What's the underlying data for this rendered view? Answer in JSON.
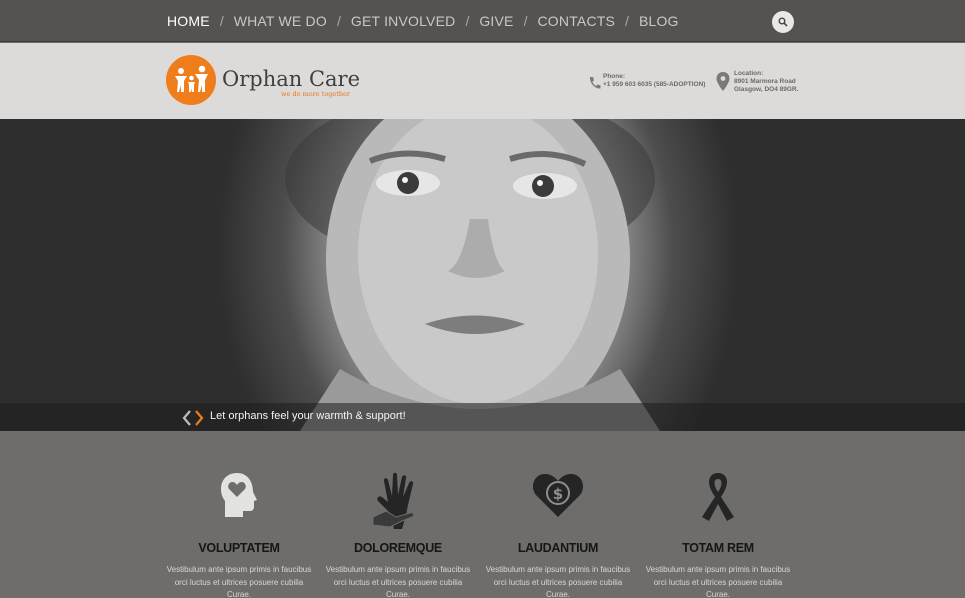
{
  "nav": {
    "items": [
      {
        "label": "HOME",
        "active": true
      },
      {
        "label": "WHAT WE DO"
      },
      {
        "label": "GET INVOLVED"
      },
      {
        "label": "GIVE"
      },
      {
        "label": "CONTACTS"
      },
      {
        "label": "BLOG"
      }
    ],
    "separator": "/",
    "search_icon": "search-icon"
  },
  "header": {
    "brand_name": "Orphan Care",
    "tagline": "we do more together",
    "phone": {
      "label": "Phone:",
      "value": "+1 959 603 6035 (585-ADOPTION)"
    },
    "location": {
      "label": "Location:",
      "line1": "8901 Marmora Road",
      "line2": "Glasgow, DO4 89GR."
    }
  },
  "hero": {
    "caption": "Let orphans feel your warmth & support!"
  },
  "features": [
    {
      "icon": "head-heart-icon",
      "title": "VOLUPTATEM",
      "text": "Vestibulum ante ipsum primis in faucibus orci luctus et ultrices posuere cubilia Curae."
    },
    {
      "icon": "helping-hands-icon",
      "title": "DOLOREMQUE",
      "text": "Vestibulum ante ipsum primis in faucibus orci luctus et ultrices posuere cubilia Curae."
    },
    {
      "icon": "heart-dollar-icon",
      "title": "LAUDANTIUM",
      "text": "Vestibulum ante ipsum primis in faucibus orci luctus et ultrices posuere cubilia Curae."
    },
    {
      "icon": "ribbon-icon",
      "title": "TOTAM REM",
      "text": "Vestibulum ante ipsum primis in faucibus orci luctus et ultrices posuere cubilia Curae."
    }
  ],
  "colors": {
    "accent": "#f07d1b",
    "nav_bg": "#555351",
    "header_bg": "#dcdbd9",
    "features_bg": "#6e6d6b"
  }
}
